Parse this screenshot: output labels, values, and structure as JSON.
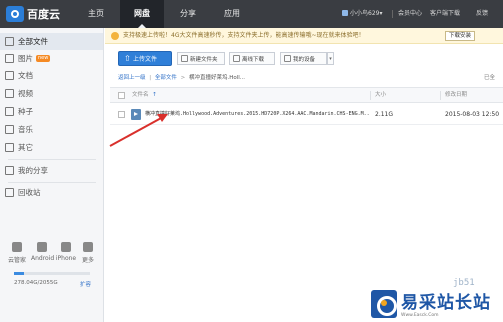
{
  "brand": {
    "name": "百度云"
  },
  "nav": {
    "items": [
      {
        "label": "主页"
      },
      {
        "label": "网盘"
      },
      {
        "label": "分享"
      },
      {
        "label": "应用"
      }
    ]
  },
  "account": {
    "username": "小小鸟629",
    "username_caret": "▾",
    "vip": "会员中心",
    "client": "客户端下载",
    "feedback": "反馈"
  },
  "sidebar": {
    "items": [
      {
        "label": "全部文件",
        "icon": "folder-icon"
      },
      {
        "label": "图片",
        "icon": "image-icon",
        "badge": "new"
      },
      {
        "label": "文档",
        "icon": "document-icon"
      },
      {
        "label": "视频",
        "icon": "video-icon"
      },
      {
        "label": "种子",
        "icon": "bt-icon"
      },
      {
        "label": "音乐",
        "icon": "music-icon"
      },
      {
        "label": "其它",
        "icon": "other-icon"
      }
    ],
    "share": "我的分享",
    "recycle": "回收站",
    "devices": [
      {
        "label": "云管家",
        "icon": "pc-icon"
      },
      {
        "label": "Android",
        "icon": "android-icon"
      },
      {
        "label": "iPhone",
        "icon": "iphone-icon"
      },
      {
        "label": "更多",
        "icon": "more-icon"
      }
    ],
    "quota": {
      "text": "278.04G/2055G",
      "used_fraction": 0.135,
      "expand": "扩容"
    }
  },
  "notice": {
    "text": "支持极速上传啦！4G大文件高速秒传，支持文件夹上传，能高速传输哦~现在就来体验吧！",
    "button": "下载安装"
  },
  "toolbar": {
    "upload": "上传文件",
    "new_folder": "新建文件夹",
    "offline": "离线下载",
    "my_devices": "我的设备",
    "caret": "▾"
  },
  "breadcrumb": {
    "back": "返回上一级",
    "sep": "|",
    "root": "全部文件",
    "gt": ">",
    "current": "横冲直撞好莱坞.Holl...",
    "count": "已全"
  },
  "table": {
    "columns": {
      "name": "文件名",
      "sort": "↑",
      "size": "大小",
      "date": "修改日期"
    },
    "rows": [
      {
        "name": "横冲直撞好莱坞.Hollywood.Adventures.2015.HD720P.X264.AAC.Mandarin.CHS-ENG.M...",
        "size": "2.11G",
        "date": "2015-08-03 12:50"
      }
    ]
  },
  "watermark": {
    "brand": "易采站长站",
    "url": "Www.Easck.Com",
    "short": "jb51"
  },
  "colors": {
    "topbar": "#3a3d42",
    "accent": "#2f7fd8",
    "notice_bg": "#fff7dd",
    "annotation_arrow": "#d9302c"
  }
}
